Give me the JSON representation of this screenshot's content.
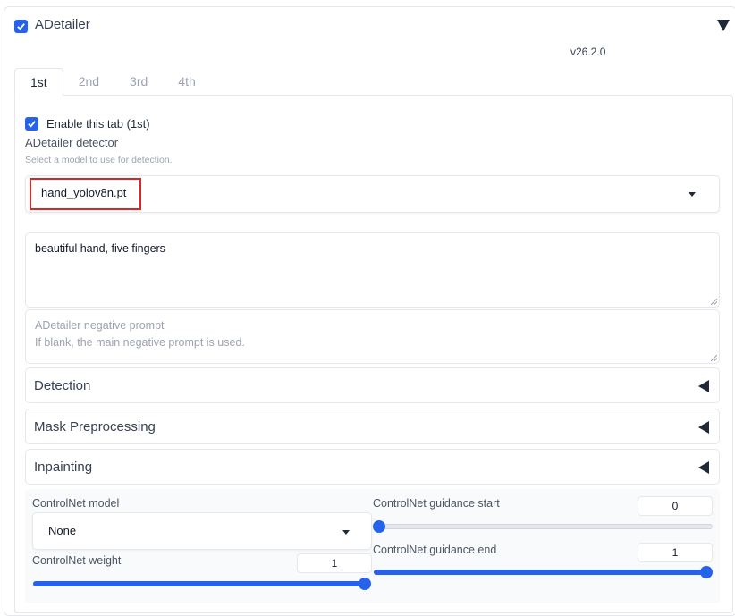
{
  "header": {
    "title": "ADetailer",
    "version": "v26.2.0",
    "enabled": true
  },
  "tabs": [
    {
      "label": "1st",
      "active": true
    },
    {
      "label": "2nd",
      "active": false
    },
    {
      "label": "3rd",
      "active": false
    },
    {
      "label": "4th",
      "active": false
    }
  ],
  "tab1": {
    "enable_label": "Enable this tab (1st)",
    "detector_label": "ADetailer detector",
    "detector_info": "Select a model to use for detection.",
    "detector_value": "hand_yolov8n.pt",
    "prompt_value": "beautiful hand, five fingers",
    "negative_placeholder": "ADetailer negative prompt\nIf blank, the main negative prompt is used.",
    "accordions": [
      {
        "label": "Detection"
      },
      {
        "label": "Mask Preprocessing"
      },
      {
        "label": "Inpainting"
      }
    ],
    "controlnet": {
      "model_label": "ControlNet model",
      "model_value": "None",
      "weight_label": "ControlNet weight",
      "weight_value": "1",
      "weight_fraction": 1.0,
      "start_label": "ControlNet guidance start",
      "start_value": "0",
      "start_fraction": 0.0,
      "end_label": "ControlNet guidance end",
      "end_value": "1",
      "end_fraction": 1.0
    }
  },
  "colors": {
    "accent": "#2563eb",
    "highlight": "#dc2626"
  }
}
